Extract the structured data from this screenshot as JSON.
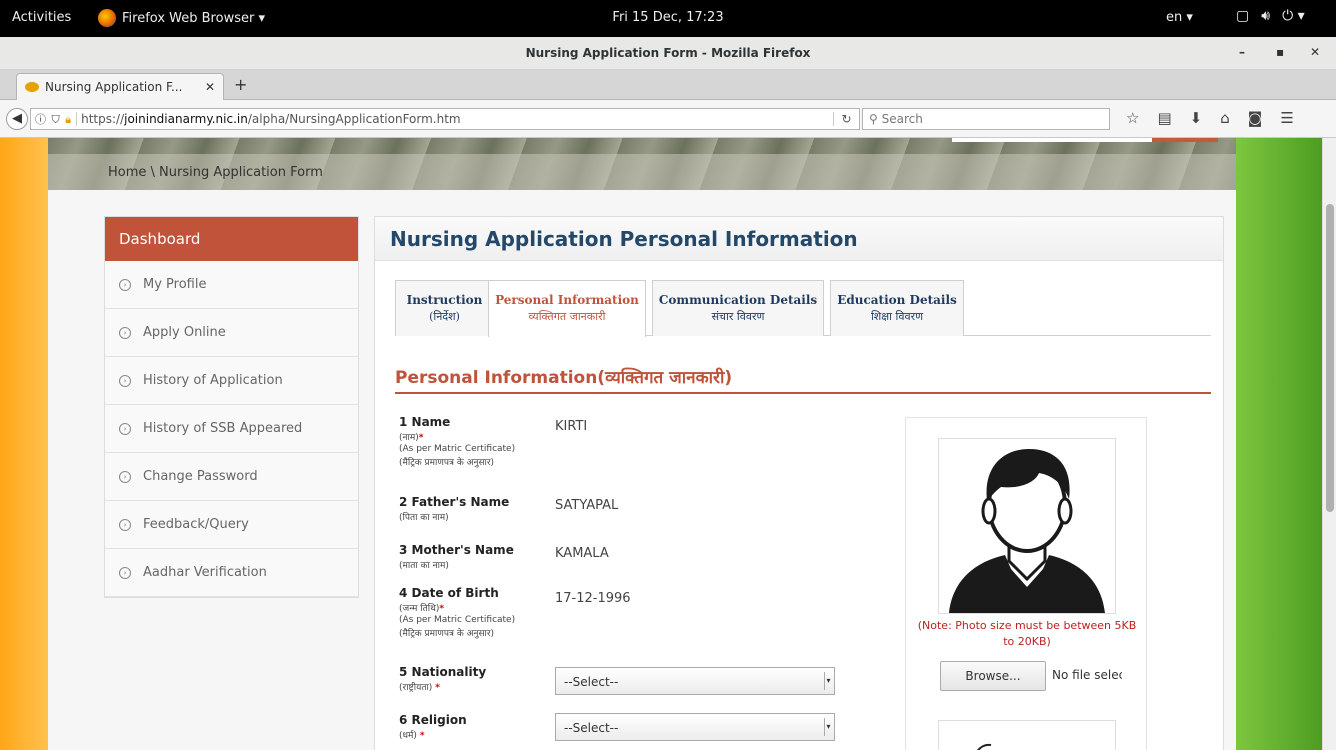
{
  "system_bar": {
    "activities": "Activities",
    "app_name": "Firefox Web Browser ▾",
    "clock": "Fri 15 Dec, 17:23",
    "language": "en ▾"
  },
  "window": {
    "title": "Nursing Application Form - Mozilla Firefox"
  },
  "browser": {
    "tab_label": "Nursing Application F...",
    "url_host": "joinindianarmy.nic.in",
    "url_prefix": "https://",
    "url_path": "/alpha/NursingApplicationForm.htm",
    "search_placeholder": "Search"
  },
  "breadcrumb": "Home  \\  Nursing Application Form",
  "sidebar": {
    "heading": "Dashboard",
    "items": [
      {
        "label": "My Profile"
      },
      {
        "label": "Apply Online"
      },
      {
        "label": "History of Application"
      },
      {
        "label": "History of SSB Appeared"
      },
      {
        "label": "Change Password"
      },
      {
        "label": "Feedback/Query"
      },
      {
        "label": "Aadhar Verification"
      }
    ]
  },
  "main": {
    "heading": "Nursing Application Personal Information",
    "tabs": [
      {
        "label": "Instruction",
        "hindi": "(निर्देश)"
      },
      {
        "label": "Personal Information",
        "hindi": "व्यक्तिगत जानकारी"
      },
      {
        "label": "Communication Details",
        "hindi": "संचार विवरण"
      },
      {
        "label": "Education Details",
        "hindi": "शिक्षा विवरण"
      }
    ],
    "active_tab": "Personal Information",
    "section_title": "Personal Information(व्यक्तिगत जानकारी)",
    "fields": {
      "name": {
        "label": "1 Name",
        "hindi": "(नाम)",
        "note1": "(As per Matric Certificate)",
        "note2": "(मैट्रिक प्रमाणपत्र के अनुसार)",
        "value": "KIRTI"
      },
      "father": {
        "label": "2 Father's Name",
        "hindi": "(पिता का नाम)",
        "value": "SATYAPAL"
      },
      "mother": {
        "label": "3 Mother's Name",
        "hindi": "(माता का नाम)",
        "value": "KAMALA"
      },
      "dob": {
        "label": "4 Date of Birth",
        "hindi": "(जन्म तिथि)",
        "note1": "(As per Matric Certificate)",
        "note2": "(मैट्रिक प्रमाणपत्र के अनुसार)",
        "value": "17-12-1996"
      },
      "nationality": {
        "label": "5 Nationality",
        "hindi": "(राष्ट्रीयता)",
        "value": "--Select--"
      },
      "religion": {
        "label": "6 Religion",
        "hindi": "(धर्म)",
        "value": "--Select--"
      }
    },
    "photo_note": "(Note: Photo size must be between 5KB to 20KB)",
    "browse_label": "Browse...",
    "no_file": "No file selected."
  },
  "colors": {
    "accent": "#c0533a",
    "heading": "#23486a"
  }
}
